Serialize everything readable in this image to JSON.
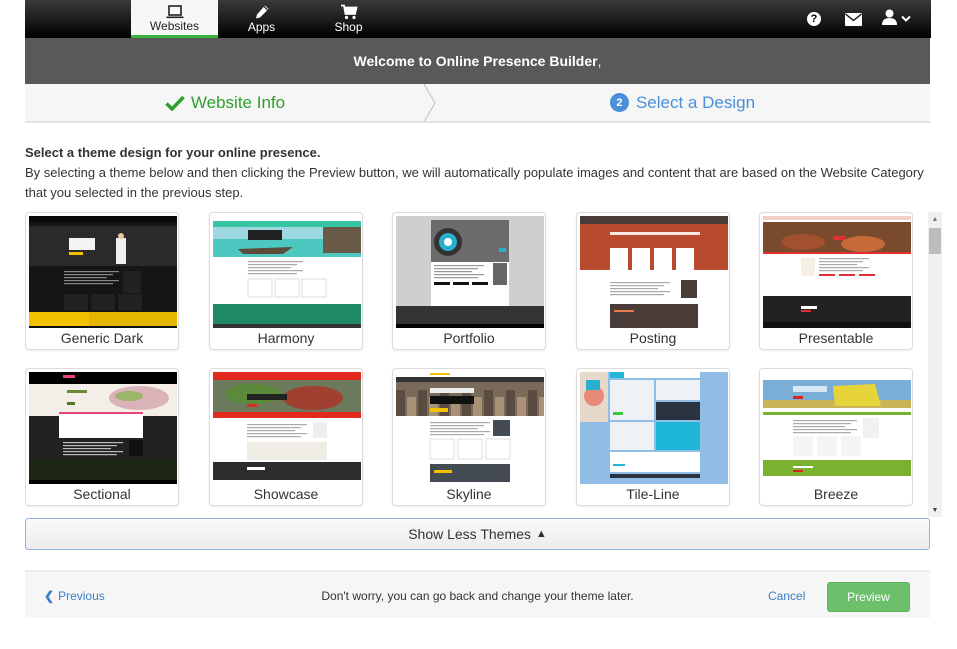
{
  "nav": {
    "tabs": [
      {
        "label": "Websites",
        "icon": "laptop-icon",
        "active": true
      },
      {
        "label": "Apps",
        "icon": "pencil-icon",
        "active": false
      },
      {
        "label": "Shop",
        "icon": "cart-icon",
        "active": false
      }
    ],
    "right_icons": [
      "help-icon",
      "mail-icon",
      "user-icon",
      "chevron-down-icon"
    ],
    "help_glyph": "?",
    "accent_active": "#3cb43c"
  },
  "welcome": {
    "text": "Welcome to Online Presence Builder",
    "suffix": ","
  },
  "steps": [
    {
      "label": "Website Info",
      "status": "complete",
      "color": "#2ea02e"
    },
    {
      "number": "2",
      "label": "Select a Design",
      "status": "current",
      "color": "#4a90d9"
    }
  ],
  "instructions": {
    "heading": "Select a theme design for your online presence.",
    "body": "By selecting a theme below and then clicking the Preview button, we will automatically populate images and content that are based on the Website Category that you selected in the previous step."
  },
  "themes": [
    {
      "name": "Generic Dark",
      "primary": "#1a1a1a",
      "accent": "#f2c200"
    },
    {
      "name": "Harmony",
      "primary": "#ffffff",
      "accent": "#1f8a63"
    },
    {
      "name": "Portfolio",
      "primary": "#cccccc",
      "accent": "#333333"
    },
    {
      "name": "Posting",
      "primary": "#b84a2e",
      "accent": "#4a3c38"
    },
    {
      "name": "Presentable",
      "primary": "#ffffff",
      "accent": "#222222"
    },
    {
      "name": "Sectional",
      "primary": "#222222",
      "accent": "#e8457a"
    },
    {
      "name": "Showcase",
      "primary": "#e3281e",
      "accent": "#2d2d2d"
    },
    {
      "name": "Skyline",
      "primary": "#ffffff",
      "accent": "#444b52"
    },
    {
      "name": "Tile-Line",
      "primary": "#8fbde6",
      "accent": "#1fb7d8"
    },
    {
      "name": "Breeze",
      "primary": "#ffffff",
      "accent": "#7ab12f"
    }
  ],
  "show_less": {
    "label": "Show Less Themes",
    "arrow": "▲"
  },
  "footer": {
    "previous_chevron": "❮",
    "previous_label": "Previous",
    "message": "Don't worry, you can go back and change your theme later.",
    "cancel_label": "Cancel",
    "preview_label": "Preview"
  },
  "scrollbar": {
    "up_arrow": "▲",
    "down_arrow": "▼",
    "position_fraction": 0.0
  }
}
